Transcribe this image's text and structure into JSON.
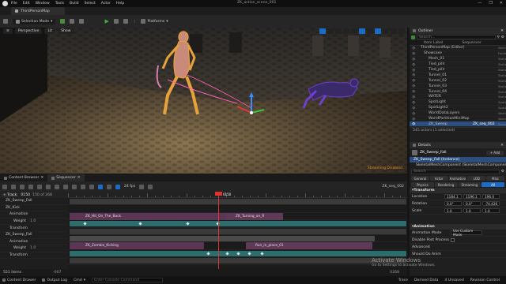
{
  "menubar": {
    "items": [
      "File",
      "Edit",
      "Window",
      "Tools",
      "Build",
      "Select",
      "Actor",
      "Help"
    ],
    "project": "ZK_action_scene_001",
    "window_controls": [
      "—",
      "❐",
      "✕"
    ]
  },
  "map_tab": {
    "label": "ThirdPersonMap"
  },
  "toolbar": {
    "mode_label": "Selection Mode",
    "platforms_label": "Platforms"
  },
  "viewport": {
    "perspective": "Perspective",
    "lit": "Lit",
    "show": "Show",
    "overlay_status": "Streaming Disabled"
  },
  "outliner": {
    "tab": "Outliner",
    "search_placeholder": "Search...",
    "col_item": "Item Label",
    "col_type": "Sequencer",
    "rows": [
      {
        "name": "ThirdPersonMap (Editor)",
        "seq": "",
        "type": "World"
      },
      {
        "name": "Showcase",
        "seq": "",
        "type": "Folder"
      },
      {
        "name": "Mesh_01",
        "seq": "",
        "type": "StaticM"
      },
      {
        "name": "Tied_pillr",
        "seq": "",
        "type": "StaticM"
      },
      {
        "name": "Tied_pillr",
        "seq": "",
        "type": "StaticM"
      },
      {
        "name": "Tunnel_01",
        "seq": "",
        "type": "StaticM"
      },
      {
        "name": "Tunnel_02",
        "seq": "",
        "type": "StaticM"
      },
      {
        "name": "Tunnel_03",
        "seq": "",
        "type": "StaticM"
      },
      {
        "name": "Tunnel_04",
        "seq": "",
        "type": "StaticM"
      },
      {
        "name": "WATER",
        "seq": "",
        "type": "StaticM"
      },
      {
        "name": "SpotLight",
        "seq": "",
        "type": "SpotLig"
      },
      {
        "name": "SpotLight2",
        "seq": "",
        "type": "SpotLig"
      },
      {
        "name": "WorldDataLayers",
        "seq": "",
        "type": "WorldD"
      },
      {
        "name": "WorldPartitionMiniMap",
        "seq": "",
        "type": "WorldP"
      },
      {
        "name": "ZK_Sweep",
        "seq": "ZK_seq_002",
        "type": "Skelet"
      }
    ],
    "selected_index": 14,
    "footer": "545 actors (1 selected)"
  },
  "details": {
    "tab": "Details",
    "actor_name": "ZK_Sweep_Fall",
    "add_label": "+ Add",
    "instance_label": "ZK_Sweep_Fall (Instance)",
    "component_label": "SkeletalMeshComponent (SkeletalMeshComponent)",
    "search_placeholder": "Search",
    "filters_row1": [
      "General",
      "Actor",
      "Animation",
      "LOD",
      "Misc"
    ],
    "filters_row2": [
      "Physics",
      "Rendering",
      "Streaming",
      "All"
    ],
    "transform_section": "Transform",
    "location_label": "Location",
    "location": [
      "1184.1",
      "1196.1",
      "196.0"
    ],
    "rotation_label": "Rotation",
    "rotation": [
      "0.0°",
      "0.0°",
      "-74.426"
    ],
    "scale_label": "Scale",
    "scale": [
      "1.0",
      "1.0",
      "1.0"
    ],
    "animation_section": "Animation",
    "anim_mode_label": "Animation Mode",
    "anim_mode_value": "Use Custom Mode",
    "disable_post_label": "Disable Post Process",
    "advanced_label": "Advanced",
    "should_do_anim_label": "Should Do Anim"
  },
  "bottom_tabs": {
    "content_browser": "Content Browser",
    "sequencer": "Sequencer"
  },
  "sequencer": {
    "fps": "24 fps",
    "sequence_name": "ZK_seq_002",
    "time_start": "0150",
    "time_mid": "0150",
    "time_end": "150 of 268",
    "playhead_label": "0150",
    "add_track": "+ Track",
    "tracks": [
      {
        "name": "ZK_Sweep_Fall",
        "indent": 1,
        "value": ""
      },
      {
        "name": "ZK_Kick",
        "indent": 1,
        "value": ""
      },
      {
        "name": "Animation",
        "indent": 2,
        "value": ""
      },
      {
        "name": "Weight",
        "indent": 3,
        "value": "1.0"
      },
      {
        "name": "Transform",
        "indent": 2,
        "value": ""
      },
      {
        "name": "ZK_Sweep_Fall",
        "indent": 1,
        "value": ""
      },
      {
        "name": "Animation",
        "indent": 2,
        "value": ""
      },
      {
        "name": "Weight",
        "indent": 3,
        "value": "1.0"
      },
      {
        "name": "Transform",
        "indent": 2,
        "value": ""
      }
    ],
    "clips": [
      {
        "label": "ZK_Hit_On_The_Back",
        "row": 2,
        "type": "anim"
      },
      {
        "label": "ZK_Turning_on_R",
        "row": 2,
        "type": "anim"
      },
      {
        "label": "ZK_Zombie_Kicking",
        "row": 6,
        "type": "anim"
      },
      {
        "label": "Run_in_place_01",
        "row": 6,
        "type": "anim"
      }
    ],
    "range_start": "-007",
    "range_end": "0268"
  },
  "items_label": "551 items",
  "status": {
    "content_drawer": "Content Drawer",
    "output_log": "Output Log",
    "cmd": "Cmd",
    "cmd_placeholder": "Enter Console Command",
    "trace": "Trace",
    "derived_data": "Derived Data",
    "unsaved": "4 Unsaved",
    "revision": "Revision Control"
  },
  "activate_windows": {
    "title": "Activate Windows",
    "subtitle": "Go to Settings to activate Windows."
  },
  "colors": {
    "accent": "#1b6cc8",
    "clip_anim": "#5a3654",
    "clip_transform": "#2e6d6d",
    "selection_orange": "#e8a23c",
    "status_warn": "#e28a2b"
  }
}
